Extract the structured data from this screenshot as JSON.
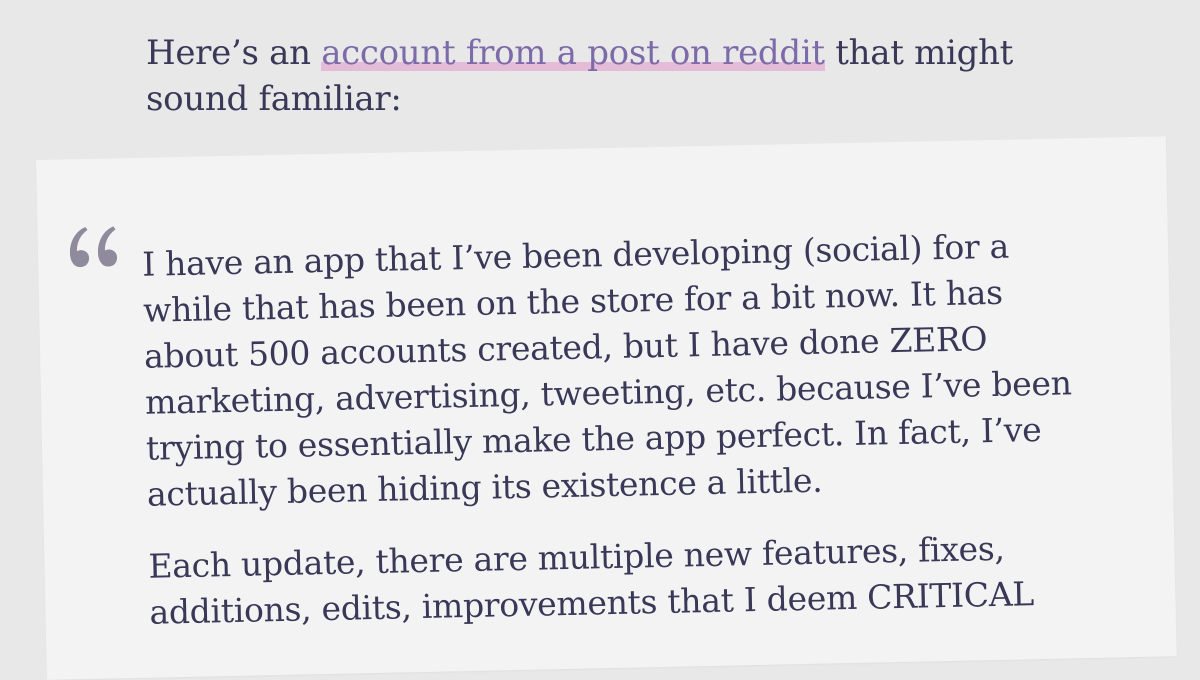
{
  "intro": {
    "before_link": "Here’s an ",
    "link_text": "account from a post on reddit",
    "after_link": " that might sound familiar:"
  },
  "quote": {
    "icon": "quote-icon",
    "paragraphs": [
      "I have an app that I’ve been developing (social) for a while that has been on the store for a bit now. It has about 500 accounts created, but I have done ZERO marketing, advertising, tweeting, etc. because I’ve been trying to essentially make the app perfect. In fact, I’ve actually been hiding its existence a little.",
      "Each update, there are multiple new features, fixes, additions, edits, improvements that I deem CRITICAL"
    ]
  },
  "colors": {
    "background": "#e8e8e9",
    "card": "#f3f3f4",
    "text": "#3a3857",
    "link": "#7d6aa8",
    "link_highlight": "#e4bcd8",
    "quote_mark": "#8f8a9c"
  }
}
